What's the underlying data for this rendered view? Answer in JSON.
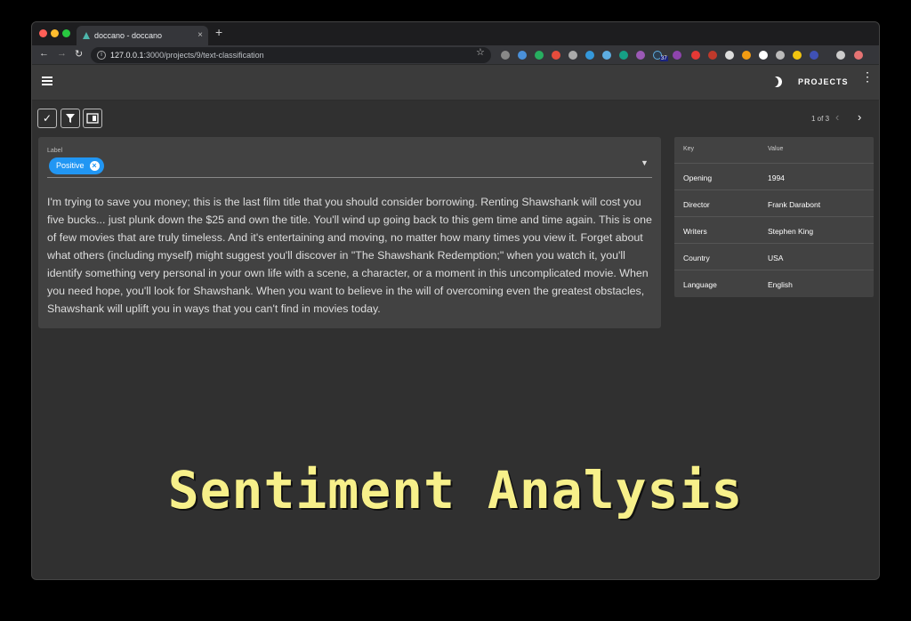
{
  "browser": {
    "tab_title": "doccano - doccano",
    "tab_close": "×",
    "new_tab": "+",
    "url_host": "127.0.0.1",
    "url_path": ":3000/projects/9/text-classification",
    "extension_badge": "37"
  },
  "appbar": {
    "projects_label": "PROJECTS"
  },
  "toolbar": {
    "pager_text": "1 of 3"
  },
  "annotation": {
    "label_caption": "Label",
    "chip_label": "Positive",
    "text": "I'm trying to save you money; this is the last film title that you should consider borrowing. Renting Shawshank will cost you five bucks... just plunk down the $25 and own the title. You'll wind up going back to this gem time and time again. This is one of few movies that are truly timeless. And it's entertaining and moving, no matter how many times you view it. Forget about what others (including myself) might suggest you'll discover in \"The Shawshank Redemption;\" when you watch it, you'll identify something very personal in your own life with a scene, a character, or a moment in this uncomplicated movie. When you need hope, you'll look for Shawshank. When you want to believe in the will of overcoming even the greatest obstacles, Shawshank will uplift you in ways that you can't find in movies today."
  },
  "metadata": {
    "header_key": "Key",
    "header_value": "Value",
    "rows": [
      {
        "key": "Opening",
        "value": "1994"
      },
      {
        "key": "Director",
        "value": "Frank Darabont"
      },
      {
        "key": "Writers",
        "value": "Stephen King"
      },
      {
        "key": "Country",
        "value": "USA"
      },
      {
        "key": "Language",
        "value": "English"
      }
    ]
  },
  "overlay_title": "Sentiment Analysis",
  "colors": {
    "chip": "#2196f3",
    "overlay_text": "#f7f08a",
    "background": "#303030",
    "card": "#424242"
  }
}
